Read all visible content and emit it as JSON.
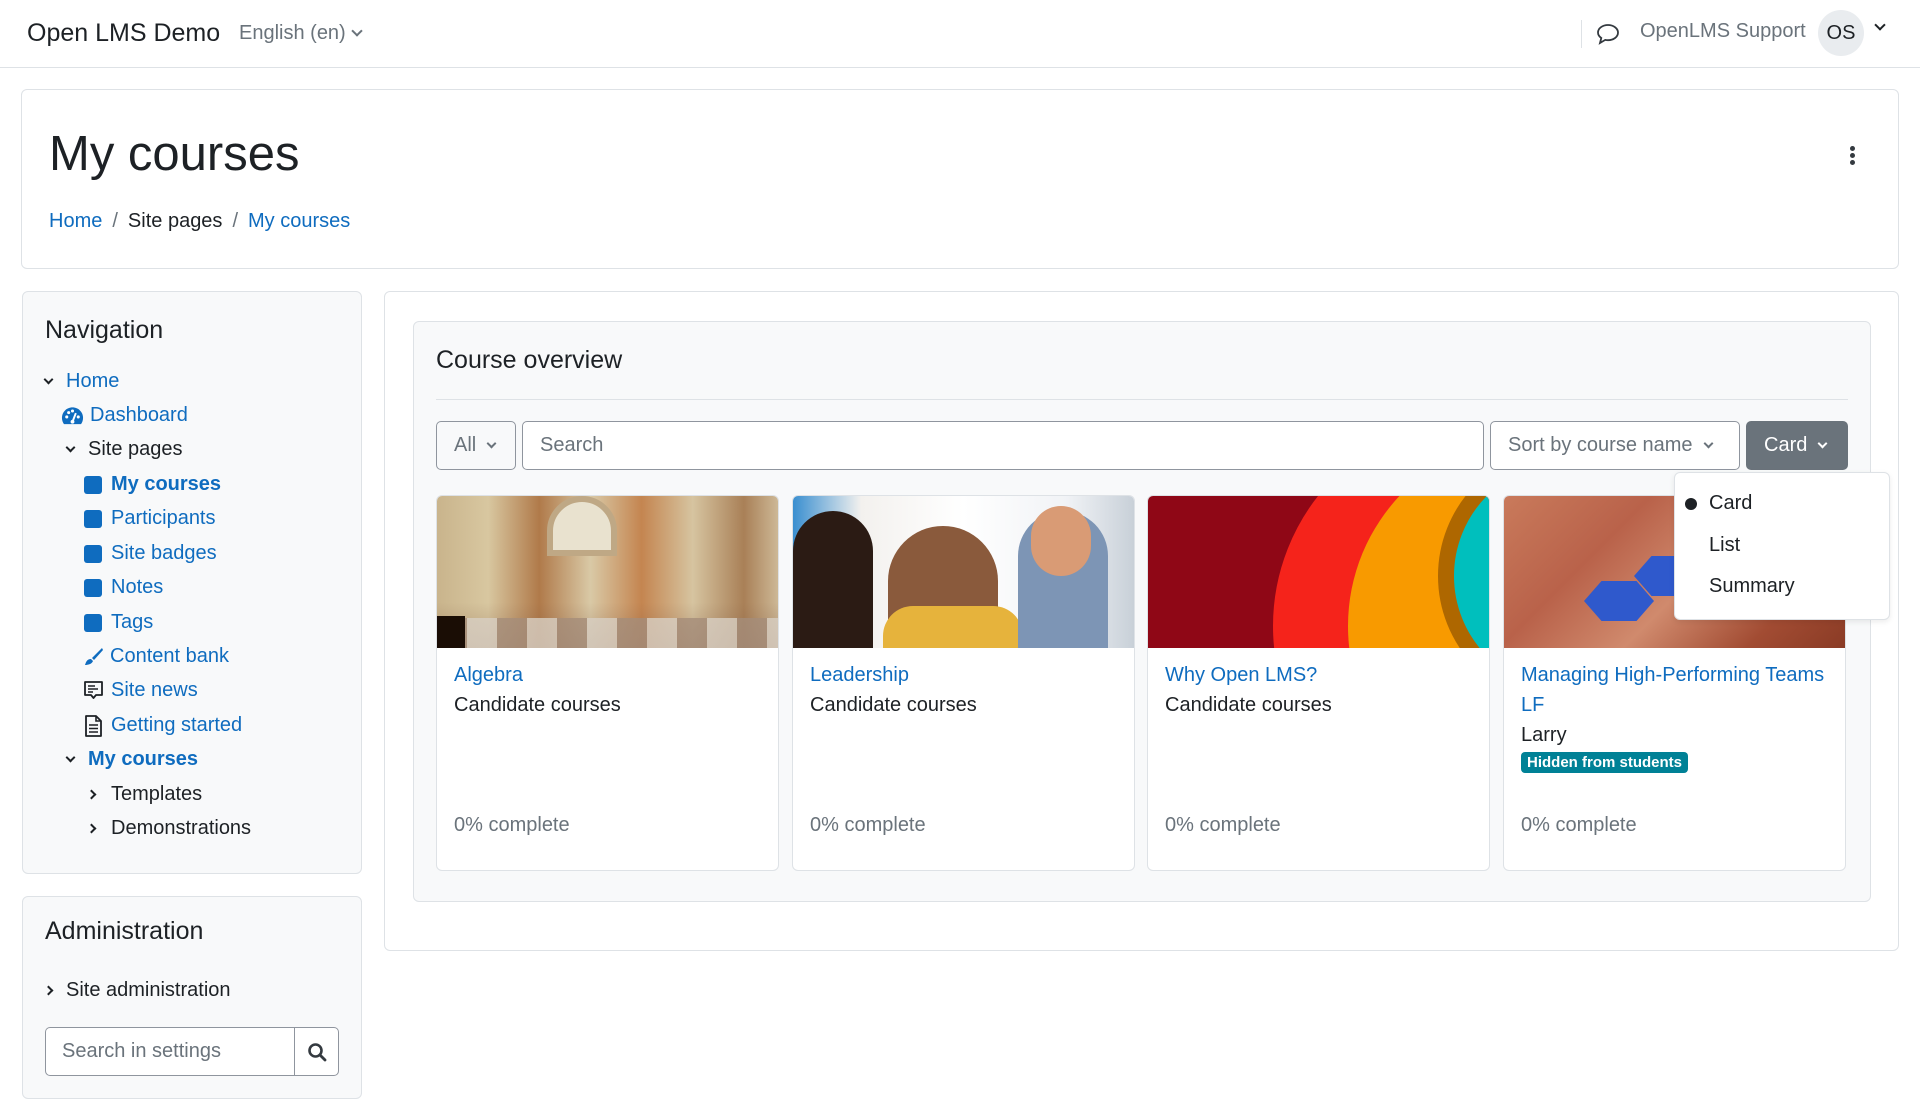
{
  "navbar": {
    "brand": "Open LMS Demo",
    "language": "English (en)",
    "user_name": "OpenLMS Support",
    "user_initials": "OS",
    "icons": {
      "messages": "speech-bubble-icon",
      "language_caret": "chevron-down-icon",
      "user_caret": "chevron-down-icon"
    }
  },
  "header": {
    "title": "My courses",
    "breadcrumb": [
      {
        "label": "Home",
        "link": true
      },
      {
        "label": "Site pages",
        "link": false
      },
      {
        "label": "My courses",
        "link": true
      }
    ],
    "separator": "/",
    "actions_icon": "kebab-menu-icon"
  },
  "navigation": {
    "title": "Navigation",
    "items": [
      {
        "label": "Home",
        "level": 0,
        "toggle": "expanded",
        "icon": null,
        "style": "link"
      },
      {
        "label": "Dashboard",
        "level": 1,
        "toggle": null,
        "icon": "dashboard-icon",
        "style": "link"
      },
      {
        "label": "Site pages",
        "level": 1,
        "toggle": "expanded",
        "icon": null,
        "style": "dark"
      },
      {
        "label": "My courses",
        "level": 2,
        "toggle": null,
        "icon": "square-icon",
        "style": "link-bold"
      },
      {
        "label": "Participants",
        "level": 2,
        "toggle": null,
        "icon": "square-icon",
        "style": "link"
      },
      {
        "label": "Site badges",
        "level": 2,
        "toggle": null,
        "icon": "square-icon",
        "style": "link"
      },
      {
        "label": "Notes",
        "level": 2,
        "toggle": null,
        "icon": "square-icon",
        "style": "link"
      },
      {
        "label": "Tags",
        "level": 2,
        "toggle": null,
        "icon": "square-icon",
        "style": "link"
      },
      {
        "label": "Content bank",
        "level": 2,
        "toggle": null,
        "icon": "paintbrush-icon",
        "style": "link"
      },
      {
        "label": "Site news",
        "level": 2,
        "toggle": null,
        "icon": "forum-icon",
        "style": "link"
      },
      {
        "label": "Getting started",
        "level": 2,
        "toggle": null,
        "icon": "page-icon",
        "style": "link"
      },
      {
        "label": "My courses",
        "level": 1,
        "toggle": "expanded",
        "icon": null,
        "style": "link-bold"
      },
      {
        "label": "Templates",
        "level": 2,
        "toggle": "collapsed",
        "icon": null,
        "style": "dark"
      },
      {
        "label": "Demonstrations",
        "level": 2,
        "toggle": "collapsed",
        "icon": null,
        "style": "dark"
      }
    ]
  },
  "administration": {
    "title": "Administration",
    "site_admin_label": "Site administration",
    "search_placeholder": "Search in settings",
    "search_value": ""
  },
  "course_overview": {
    "title": "Course overview",
    "filter_label": "All",
    "search_placeholder": "Search",
    "search_value": "",
    "sort_label": "Sort by course name",
    "view_label": "Card",
    "view_menu": {
      "open": true,
      "options": [
        {
          "label": "Card",
          "selected": true
        },
        {
          "label": "List",
          "selected": false
        },
        {
          "label": "Summary",
          "selected": false
        }
      ]
    },
    "courses": [
      {
        "name": "Algebra",
        "category": "Candidate courses",
        "progress_percent": 0,
        "progress_text": "0% complete",
        "badge": null,
        "image": "school-of-athens-painting"
      },
      {
        "name": "Leadership",
        "category": "Candidate courses",
        "progress_percent": 0,
        "progress_text": "0% complete",
        "badge": null,
        "image": "team-whiteboard-photo"
      },
      {
        "name": "Why Open LMS?",
        "category": "Candidate courses",
        "progress_percent": 0,
        "progress_text": "0% complete",
        "badge": null,
        "image": "colorful-arcs"
      },
      {
        "name": "Managing High-Performing Teams LF",
        "category": "Larry",
        "progress_percent": 0,
        "progress_text": "0% complete",
        "badge": "Hidden from students",
        "image": "hexagon-pattern"
      }
    ]
  },
  "colors": {
    "link": "#0f6cbf",
    "text": "#1d2125",
    "muted": "#6a737b",
    "badge": "#008196",
    "view_button": "#6a737b",
    "block_bg": "#f8f9fa",
    "border": "#dee2e6"
  }
}
